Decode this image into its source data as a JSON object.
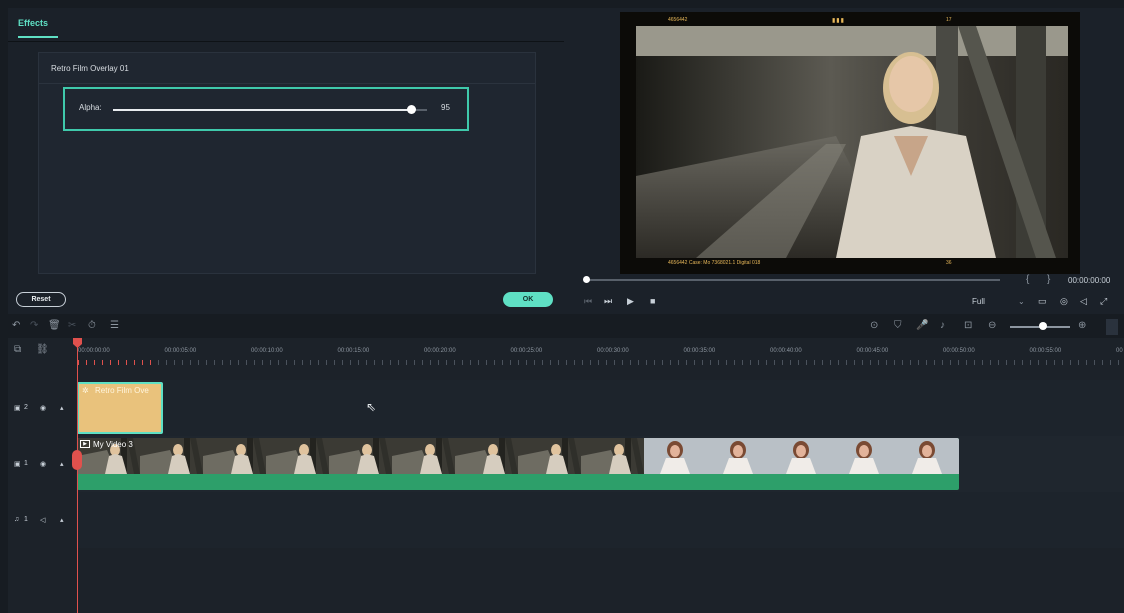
{
  "effects": {
    "tab_label": "Effects",
    "effect_name": "Retro Film Overlay 01",
    "alpha_label": "Alpha:",
    "alpha_value": "95",
    "alpha_fraction": 0.95,
    "reset_label": "Reset",
    "ok_label": "OK"
  },
  "preview": {
    "film_top_code": "4656442",
    "film_top_mark": "▮▮▮",
    "film_top_num": "17",
    "film_bottom_text": "4656442   Case: Mo 7368021.1  Digital 018",
    "film_bottom_num": "36",
    "mark_in": "{",
    "mark_out": "}",
    "timecode": "00:00:00:00",
    "quality": "Full",
    "controls": {
      "step_back": "⏮",
      "frame_forward": "⏭",
      "play": "▶",
      "stop": "■"
    }
  },
  "toolbar": {
    "undo": "↶",
    "redo": "↷",
    "delete": "🗑",
    "cut": "✂",
    "speed": "⏱",
    "adjust": "☰",
    "render": "⊙",
    "mask": "⛉",
    "mic": "🎤",
    "voiceover": "♪",
    "subtitle": "⊡",
    "zoom_out": "⊖",
    "zoom_in": "⊕",
    "zoom_level": 0.55
  },
  "timeline": {
    "ticks": [
      "00:00:00:00",
      "00:00:05:00",
      "00:00:10:00",
      "00:00:15:00",
      "00:00:20:00",
      "00:00:25:00",
      "00:00:30:00",
      "00:00:35:00",
      "00:00:40:00",
      "00:00:45:00",
      "00:00:50:00",
      "00:00:55:00",
      "00"
    ],
    "tracks": [
      {
        "id": "v2",
        "label": "2",
        "type": "video"
      },
      {
        "id": "v1",
        "label": "1",
        "type": "video"
      },
      {
        "id": "a1",
        "label": "1",
        "type": "audio"
      }
    ],
    "overlay_clip_label": "Retro Film Ove",
    "video_clip_label": "My Video 3",
    "playhead_time": "00:00:00:00"
  }
}
